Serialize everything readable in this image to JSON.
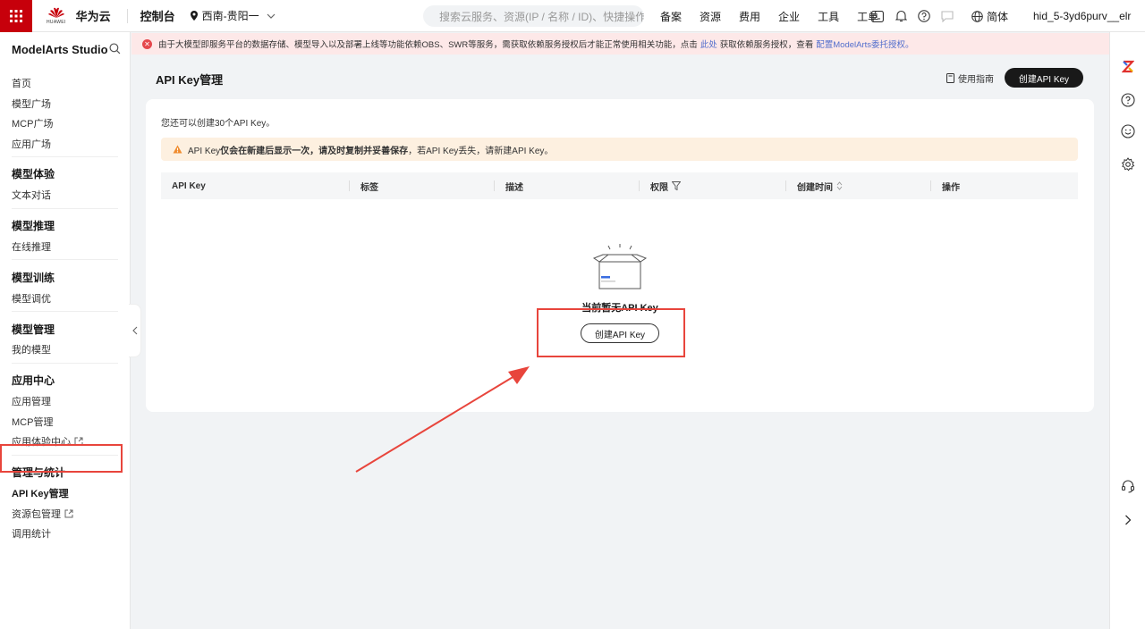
{
  "topnav": {
    "brand_sub": "HUAWEI",
    "brand": "华为云",
    "console": "控制台",
    "region": "西南-贵阳一",
    "search_placeholder": "搜索云服务、资源(IP / 名称 / ID)、快捷操作...",
    "menu": [
      "备案",
      "资源",
      "费用",
      "企业",
      "工具",
      "工单"
    ],
    "lang": "简体",
    "user": "hid_5-3yd6purv__elr"
  },
  "sidebar": {
    "title": "ModelArts Studio",
    "top_items": [
      "首页",
      "模型广场",
      "MCP广场",
      "应用广场"
    ],
    "groups": [
      {
        "title": "模型体验",
        "items": [
          "文本对话"
        ]
      },
      {
        "title": "模型推理",
        "items": [
          "在线推理"
        ]
      },
      {
        "title": "模型训练",
        "items": [
          "模型调优"
        ]
      },
      {
        "title": "模型管理",
        "items": [
          "我的模型"
        ]
      },
      {
        "title": "应用中心",
        "items": [
          "应用管理",
          "MCP管理",
          "应用体验中心"
        ]
      },
      {
        "title": "管理与统计",
        "items": [
          "API Key管理",
          "资源包管理",
          "调用统计"
        ]
      }
    ]
  },
  "alert": {
    "text_before": "由于大模型即服务平台的数据存储、模型导入以及部署上线等功能依赖OBS、SWR等服务，需获取依赖服务授权后才能正常使用相关功能，点击",
    "link1": "此处",
    "text_mid": "获取依赖服务授权，查看",
    "link2": "配置ModelArts委托授权。"
  },
  "page": {
    "title": "API Key管理",
    "guide": "使用指南",
    "create_btn": "创建API Key"
  },
  "card": {
    "quota": "您还可以创建30个API Key。",
    "warn_pre": "API Key",
    "warn_bold": "仅会在新建后显示一次，请及时复制并妥善保存",
    "warn_post": "，若API Key丢失，请新建API Key。",
    "columns": [
      "API Key",
      "标签",
      "描述",
      "权限",
      "创建时间",
      "操作"
    ],
    "empty_text": "当前暂无API Key",
    "empty_btn": "创建API Key"
  },
  "colors": {
    "brand_red": "#c7000b",
    "highlight": "#e8453c",
    "link": "#526ecc"
  }
}
